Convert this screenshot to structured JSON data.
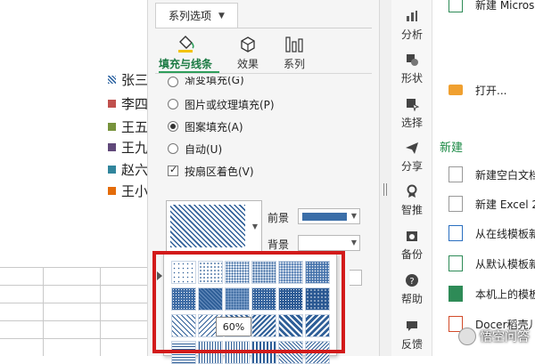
{
  "sheet": {
    "legend": [
      {
        "label": "张三",
        "color": "#3b6ea8"
      },
      {
        "label": "李四",
        "color": "#c0504d"
      },
      {
        "label": "王五",
        "color": "#77933c"
      },
      {
        "label": "王九",
        "color": "#60497a"
      },
      {
        "label": "赵六",
        "color": "#31859c"
      },
      {
        "label": "王小",
        "color": "#e46c0a"
      }
    ]
  },
  "pane": {
    "series_tab": "系列选项",
    "subtabs": [
      "填充与线条",
      "效果",
      "系列"
    ],
    "fill_options": {
      "gradient": "渐变填充(G)",
      "picture": "图片或纹理填充(P)",
      "pattern": "图案填充(A)",
      "auto": "自动(U)",
      "vary_colors": "按扇区着色(V)"
    },
    "foreground_label": "前景",
    "background_label": "背景",
    "foreground_color": "#3b6ea8",
    "tooltip": "60%"
  },
  "sidebar": {
    "items": [
      "分析",
      "形状",
      "选择",
      "分享",
      "智推",
      "备份",
      "帮助",
      "反馈"
    ]
  },
  "docs": {
    "top_item": "新建 Microsoft",
    "open": "打开...",
    "new_heading": "新建",
    "items": [
      "新建空白文档",
      "新建 Excel 2",
      "从在线模板新",
      "从默认模板新",
      "本机上的模板",
      "Docer稻壳儿"
    ]
  },
  "watermark": "悟空问答"
}
